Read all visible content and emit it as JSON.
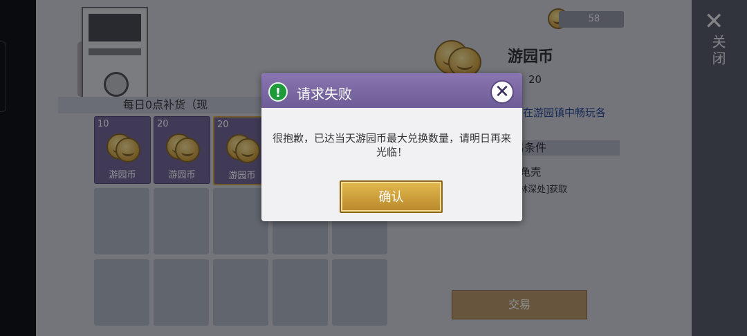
{
  "top_bar": {
    "close_label": "关闭",
    "close_icon": "close-icon"
  },
  "wallet": {
    "amount": "58"
  },
  "shop": {
    "restock_text": "每日0点补货（现",
    "items": [
      {
        "qty": "10",
        "name": "游园币"
      },
      {
        "qty": "20",
        "name": "游园币"
      },
      {
        "qty": "20",
        "name": "游园币"
      }
    ]
  },
  "detail": {
    "title": "游园币",
    "quantity": "量：20",
    "description": "在游园镇中畅玩各",
    "conditions_label": "交易条件",
    "required_item": "鳄龟壳",
    "required_prefix": "(  )",
    "source": "迷雾森林深处]获取",
    "trade_button": "交易"
  },
  "dialog": {
    "title": "请求失败",
    "message": "很抱歉，已达当天游园币最大兑换数量，请明日再来光临！",
    "confirm": "确认"
  },
  "colors": {
    "accent_purple": "#6d5c96",
    "gold": "#c99a3b",
    "warn_green": "#1e9a3a"
  }
}
